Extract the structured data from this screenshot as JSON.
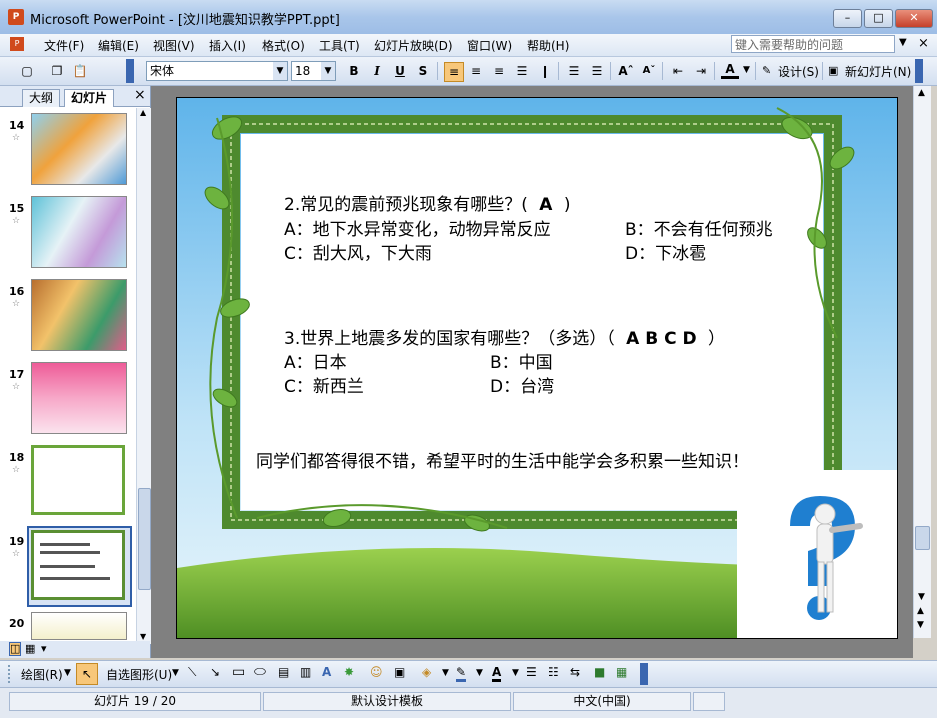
{
  "window": {
    "title": "Microsoft PowerPoint - [汶川地震知识教学PPT.ppt]",
    "app_icon": "powerpoint-icon"
  },
  "menu": {
    "items": [
      "文件(F)",
      "编辑(E)",
      "视图(V)",
      "插入(I)",
      "格式(O)",
      "工具(T)",
      "幻灯片放映(D)",
      "窗口(W)",
      "帮助(H)"
    ],
    "help_placeholder": "键入需要帮助的问题"
  },
  "toolbar": {
    "font": "宋体",
    "size": "18",
    "bold": "B",
    "italic": "I",
    "underline": "U",
    "shadow": "S",
    "design_label": "设计(S)",
    "new_slide_label": "新幻灯片(N)"
  },
  "panes": {
    "tab_outline": "大纲",
    "tab_slides": "幻灯片",
    "close": "×"
  },
  "thumbnails": [
    {
      "num": "14"
    },
    {
      "num": "15"
    },
    {
      "num": "16"
    },
    {
      "num": "17"
    },
    {
      "num": "18"
    },
    {
      "num": "19"
    },
    {
      "num": "20"
    }
  ],
  "slide": {
    "q2": {
      "question": "2.常见的震前预兆现象有哪些？(",
      "answer": "A",
      "close": ")",
      "a": "A：地下水异常变化，动物异常反应",
      "b": "B：不会有任何预兆",
      "c": "C：刮大风，下大雨",
      "d": "D：下冰雹"
    },
    "q3": {
      "question": "3.世界上地震多发的国家有哪些？（多选）（",
      "answer": "A B C D",
      "close": "）",
      "a": "A：日本",
      "b": "B：中国",
      "c": "C：新西兰",
      "d": "D：台湾"
    },
    "closing": "同学们都答得很不错，希望平时的生活中能学会多积累一些知识！"
  },
  "drawing": {
    "draw_label": "绘图(R)",
    "autoshape_label": "自选图形(U)"
  },
  "status": {
    "slide_pos": "幻灯片 19 / 20",
    "template": "默认设计模板",
    "language": "中文(中国)"
  },
  "colors": {
    "frame_green": "#4e8a2e",
    "sky": "#7fc3ee",
    "grass": "#6fae3a",
    "selected_thumb": "#2f5ea8"
  }
}
